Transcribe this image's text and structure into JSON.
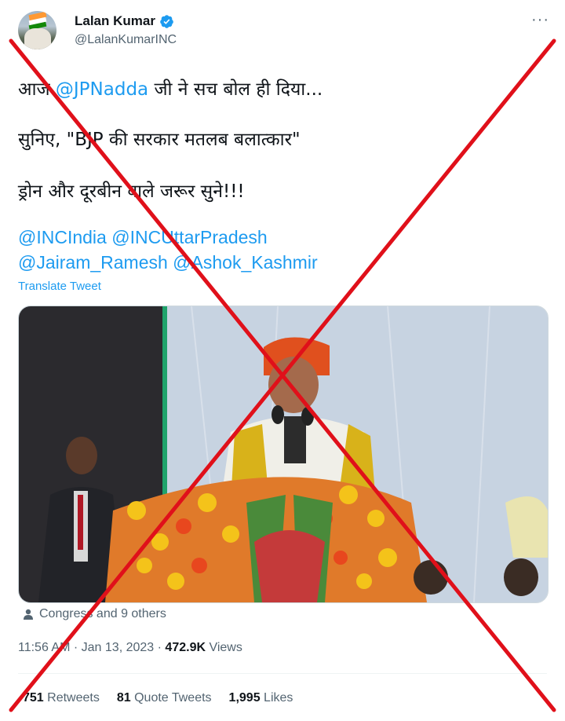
{
  "author": {
    "name": "Lalan Kumar",
    "handle": "@LalanKumarINC",
    "verified_color": "#1d9bf0"
  },
  "more_label": "···",
  "tweet": {
    "line1_prefix": "आज ",
    "line1_mention": "@JPNadda",
    "line1_suffix": " जी ने सच बोल ही दिया...",
    "line2": "सुनिए, \"BJP की सरकार मतलब बलात्कार\"",
    "line3": "ड्रोन और दूरबीन वाले जरूर सुने!!!",
    "tags_line1": "@INCIndia @INCUttarPradesh",
    "tags_line2": "@Jairam_Ramesh @Ashok_Kashmir"
  },
  "translate_label": "Translate Tweet",
  "liked_by": "Congress and 9 others",
  "meta": {
    "time": "11:56 AM",
    "date": "Jan 13, 2023",
    "views_count": "472.9K",
    "views_label": "Views",
    "separator": "·"
  },
  "stats": {
    "retweets_count": "751",
    "retweets_label": "Retweets",
    "quotes_count": "81",
    "quotes_label": "Quote Tweets",
    "likes_count": "1,995",
    "likes_label": "Likes"
  },
  "overlay_cross_color": "#e0101a"
}
